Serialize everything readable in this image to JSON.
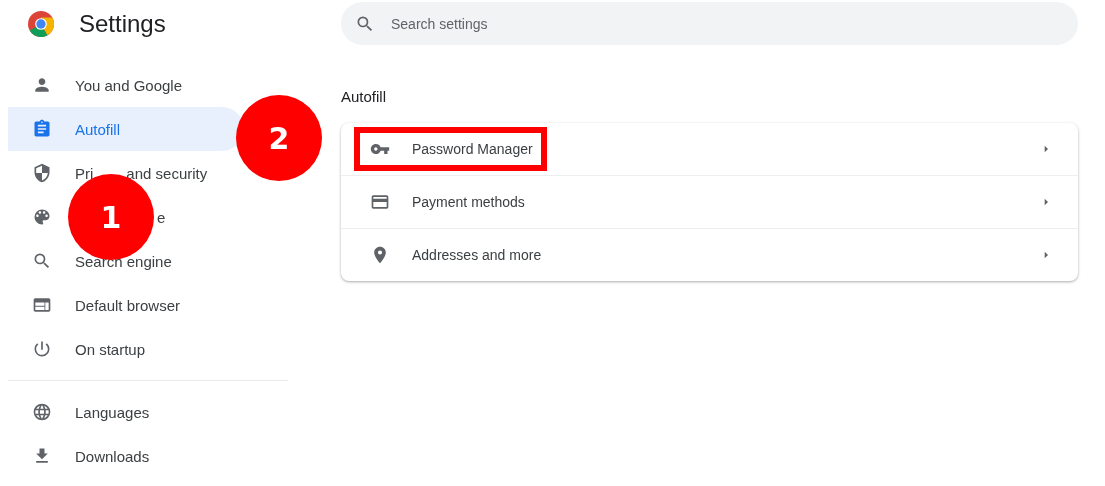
{
  "app": {
    "title": "Settings"
  },
  "search": {
    "placeholder": "Search settings"
  },
  "sidebar": {
    "groups": [
      {
        "items": [
          {
            "label": "You and Google",
            "selected": false
          },
          {
            "label": "Autofill",
            "selected": true
          },
          {
            "label_start": "Pri",
            "label_end": "and security",
            "selected": false
          },
          {
            "label_end": "e",
            "selected": false
          },
          {
            "label": "Search engine",
            "selected": false
          },
          {
            "label": "Default browser",
            "selected": false
          },
          {
            "label": "On startup",
            "selected": false
          }
        ]
      },
      {
        "items": [
          {
            "label": "Languages",
            "selected": false
          },
          {
            "label": "Downloads",
            "selected": false
          }
        ]
      }
    ]
  },
  "section": {
    "title": "Autofill",
    "rows": [
      {
        "label": "Password Manager",
        "highlighted": true
      },
      {
        "label": "Payment methods",
        "highlighted": false
      },
      {
        "label": "Addresses and more",
        "highlighted": false
      }
    ]
  },
  "annotations": [
    {
      "label": "1"
    },
    {
      "label": "2"
    }
  ]
}
